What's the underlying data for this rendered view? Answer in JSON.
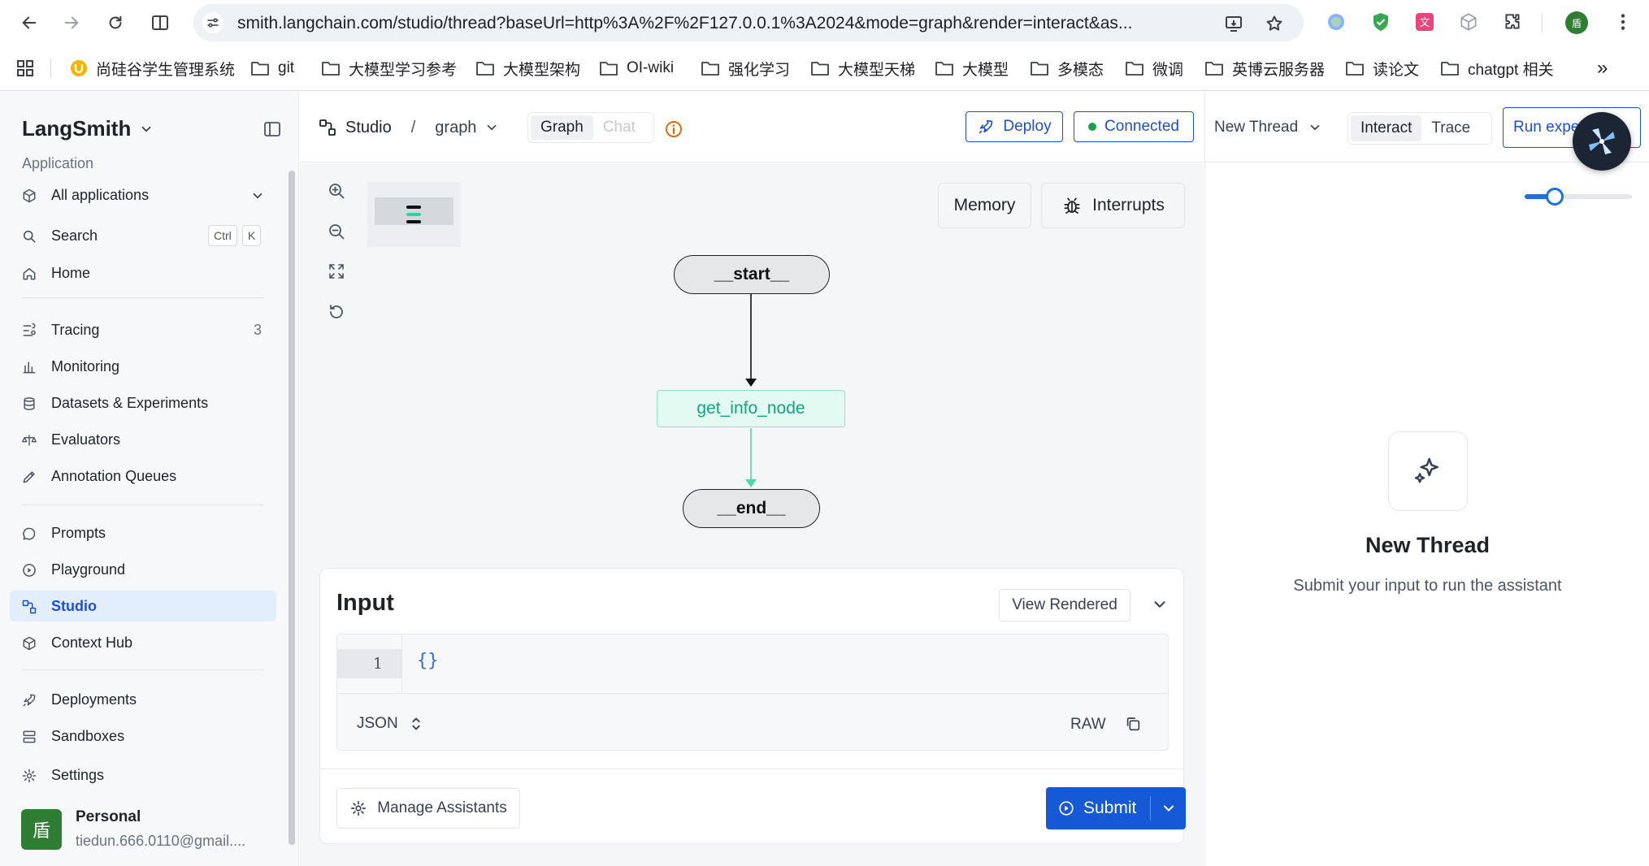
{
  "browser": {
    "url": "smith.langchain.com/studio/thread?baseUrl=http%3A%2F%2F127.0.0.1%3A2024&mode=graph&render=interact&as...",
    "profile_initial": "盾",
    "bookmarks": [
      {
        "label": "尚硅谷学生管理系统",
        "icon": "favicon-icon"
      },
      {
        "label": "git",
        "icon": "folder-icon"
      },
      {
        "label": "大模型学习参考",
        "icon": "folder-icon"
      },
      {
        "label": "大模型架构",
        "icon": "folder-icon"
      },
      {
        "label": "OI-wiki",
        "icon": "folder-icon"
      },
      {
        "label": "强化学习",
        "icon": "folder-icon"
      },
      {
        "label": "大模型天梯",
        "icon": "folder-icon"
      },
      {
        "label": "大模型",
        "icon": "folder-icon"
      },
      {
        "label": "多模态",
        "icon": "folder-icon"
      },
      {
        "label": "微调",
        "icon": "folder-icon"
      },
      {
        "label": "英博云服务器",
        "icon": "folder-icon"
      },
      {
        "label": "读论文",
        "icon": "folder-icon"
      },
      {
        "label": "chatgpt 相关",
        "icon": "folder-icon"
      }
    ],
    "bookmarks_overflow": "»"
  },
  "sidebar": {
    "brand": "LangSmith",
    "section_label": "Application",
    "items": [
      {
        "label": "All applications",
        "icon": "cube-icon"
      },
      {
        "label": "Search",
        "icon": "search-icon",
        "shortcut": [
          "Ctrl",
          "K"
        ]
      },
      {
        "label": "Home",
        "icon": "home-icon"
      },
      {
        "label": "Tracing",
        "icon": "tracing-icon",
        "count": "3"
      },
      {
        "label": "Monitoring",
        "icon": "chart-icon"
      },
      {
        "label": "Datasets & Experiments",
        "icon": "database-icon"
      },
      {
        "label": "Evaluators",
        "icon": "scale-icon"
      },
      {
        "label": "Annotation Queues",
        "icon": "pen-icon"
      },
      {
        "label": "Prompts",
        "icon": "chat-icon"
      },
      {
        "label": "Playground",
        "icon": "play-icon"
      },
      {
        "label": "Studio",
        "icon": "studio-icon",
        "active": true
      },
      {
        "label": "Context Hub",
        "icon": "box-icon"
      },
      {
        "label": "Deployments",
        "icon": "rocket-icon"
      },
      {
        "label": "Sandboxes",
        "icon": "server-icon"
      },
      {
        "label": "Settings",
        "icon": "gear-icon"
      }
    ],
    "user": {
      "avatar_initial": "盾",
      "name": "Personal",
      "email": "tiedun.666.0110@gmail...."
    }
  },
  "studio_header": {
    "crumb_root": "Studio",
    "crumb_separator": "/",
    "graph_name": "graph",
    "mode_graph": "Graph",
    "mode_chat": "Chat",
    "deploy_label": "Deploy",
    "connected_label": "Connected"
  },
  "canvas": {
    "memory_label": "Memory",
    "interrupts_label": "Interrupts",
    "nodes": {
      "start": "__start__",
      "get_info": "get_info_node",
      "end": "__end__"
    }
  },
  "input_panel": {
    "title": "Input",
    "view_rendered_label": "View Rendered",
    "line_number": "1",
    "code": "{}",
    "format": "JSON",
    "raw_label": "RAW",
    "manage_assistants_label": "Manage Assistants",
    "submit_label": "Submit"
  },
  "right_panel": {
    "thread_select": "New Thread",
    "view_interact": "Interact",
    "view_trace": "Trace",
    "run_experiment_label": "Run experiment",
    "slider_value": 0.28,
    "empty_title": "New Thread",
    "empty_subtitle": "Submit your input to run the assistant"
  },
  "colors": {
    "accent": "#1d4ed8",
    "submit": "#1559d6",
    "node_green": "#14a37f",
    "connected": "#16a34a",
    "info": "#e06c0a"
  }
}
